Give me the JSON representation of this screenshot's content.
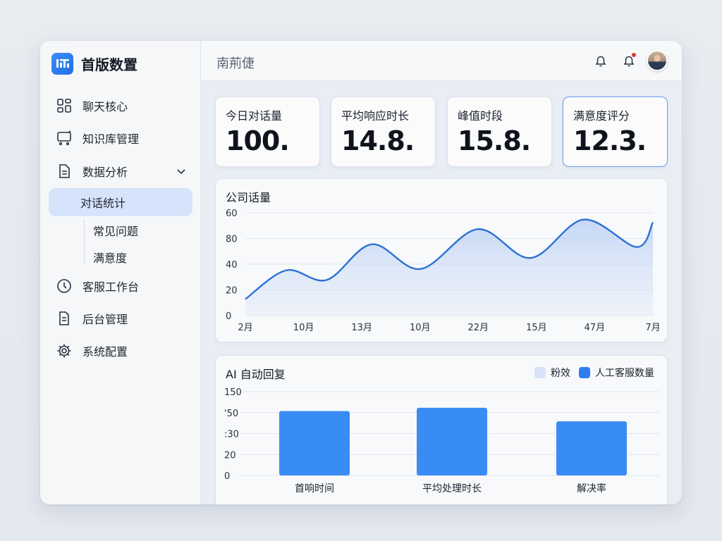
{
  "brand": {
    "name": "首版数置"
  },
  "sidebar": {
    "items": [
      {
        "label": "聊天核心",
        "icon": "grid-icon"
      },
      {
        "label": "知识库管理",
        "icon": "cart-icon"
      },
      {
        "label": "数据分析",
        "icon": "document-icon"
      },
      {
        "label": "客服工作台",
        "icon": "clock-icon"
      },
      {
        "label": "后台管理",
        "icon": "file-icon"
      },
      {
        "label": "系统配置",
        "icon": "gear-icon"
      }
    ],
    "sub_items": [
      {
        "label": "对话统计",
        "active": true
      },
      {
        "label": "常见问题"
      },
      {
        "label": "满意度"
      }
    ]
  },
  "header": {
    "title": "南荊倢"
  },
  "stats": [
    {
      "label": "今日对话量",
      "value": "100."
    },
    {
      "label": "平均响应时长",
      "value": "14.8."
    },
    {
      "label": "峰值时段",
      "value": "15.8."
    },
    {
      "label": "满意度评分",
      "value": "12.3."
    }
  ],
  "colors": {
    "accent": "#2f7df0",
    "line": "#2c71d6",
    "bar": "#3a8cf5",
    "legend_light": "#d6e3f8"
  },
  "chart_data": [
    {
      "type": "area",
      "title": "公司话量",
      "yticks": [
        "60",
        "80",
        "40",
        "20",
        "0"
      ],
      "xticks": [
        "2月",
        "10月",
        "13月",
        "10月",
        "22月",
        "15月",
        "47月",
        "7月"
      ],
      "ylim": [
        0,
        75
      ],
      "x": [
        0,
        0.1,
        0.2,
        0.31,
        0.43,
        0.57,
        0.7,
        0.83,
        0.96,
        1
      ],
      "values": [
        12,
        33,
        26,
        52,
        34,
        63,
        42,
        70,
        50,
        68
      ]
    },
    {
      "type": "bar",
      "title": "AI 自动回复",
      "legend": [
        "粉效",
        "人工客服数量"
      ],
      "yticks": [
        "150",
        "'50",
        ":30",
        "20",
        "0"
      ],
      "categories": [
        "首响时间",
        "平均处理时长",
        "解决率"
      ],
      "values": [
        100,
        105,
        84
      ],
      "ylim": [
        0,
        130
      ]
    }
  ]
}
